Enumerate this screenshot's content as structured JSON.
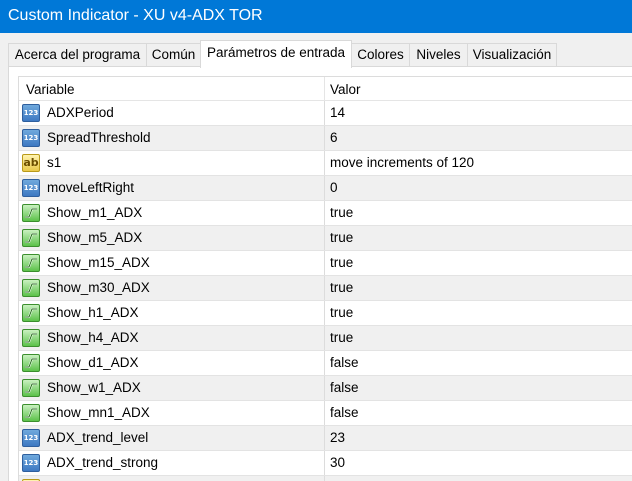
{
  "window": {
    "title": "Custom Indicator - XU v4-ADX TOR"
  },
  "tabs": [
    {
      "label": "Acerca del programa"
    },
    {
      "label": "Común"
    },
    {
      "label": "Parámetros de entrada"
    },
    {
      "label": "Colores"
    },
    {
      "label": "Niveles"
    },
    {
      "label": "Visualización"
    }
  ],
  "active_tab": "Parámetros de entrada",
  "table": {
    "headers": {
      "variable": "Variable",
      "valor": "Valor"
    },
    "rows": [
      {
        "icon": "number-icon",
        "name": "ADXPeriod",
        "value": "14"
      },
      {
        "icon": "number-icon",
        "name": "SpreadThreshold",
        "value": "6"
      },
      {
        "icon": "string-icon",
        "name": "s1",
        "value": "move increments of 120"
      },
      {
        "icon": "number-icon",
        "name": "moveLeftRight",
        "value": "0"
      },
      {
        "icon": "boolean-icon",
        "name": "Show_m1_ADX",
        "value": "true"
      },
      {
        "icon": "boolean-icon",
        "name": "Show_m5_ADX",
        "value": "true"
      },
      {
        "icon": "boolean-icon",
        "name": "Show_m15_ADX",
        "value": "true"
      },
      {
        "icon": "boolean-icon",
        "name": "Show_m30_ADX",
        "value": "true"
      },
      {
        "icon": "boolean-icon",
        "name": "Show_h1_ADX",
        "value": "true"
      },
      {
        "icon": "boolean-icon",
        "name": "Show_h4_ADX",
        "value": "true"
      },
      {
        "icon": "boolean-icon",
        "name": "Show_d1_ADX",
        "value": "false"
      },
      {
        "icon": "boolean-icon",
        "name": "Show_w1_ADX",
        "value": "false"
      },
      {
        "icon": "boolean-icon",
        "name": "Show_mn1_ADX",
        "value": "false"
      },
      {
        "icon": "number-icon",
        "name": "ADX_trend_level",
        "value": "23"
      },
      {
        "icon": "number-icon",
        "name": "ADX_trend_strong",
        "value": "30"
      },
      {
        "icon": "string-icon",
        "name": "",
        "value": ""
      }
    ]
  },
  "icon_text": {
    "number": "123",
    "string": "ab"
  },
  "colors": {
    "titlebar": "#0078d7",
    "alt_row": "#f0f0f0"
  }
}
